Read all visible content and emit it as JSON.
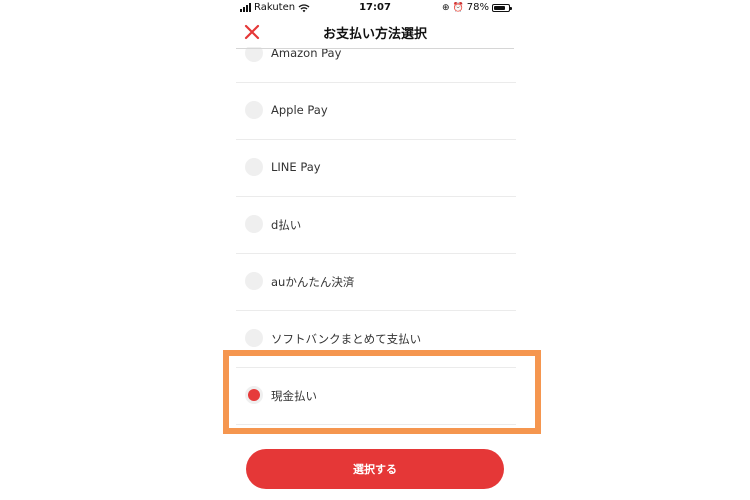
{
  "status_bar": {
    "carrier": "Rakuten",
    "time": "17:07",
    "battery": "78%",
    "battery_level": 0.78
  },
  "header": {
    "title": "お支払い方法選択",
    "close_icon": "close-x-icon",
    "accent_color": "#e53737"
  },
  "payment_methods": [
    {
      "label": "Amazon Pay",
      "selected": false
    },
    {
      "label": "Apple Pay",
      "selected": false
    },
    {
      "label": "LINE Pay",
      "selected": false
    },
    {
      "label": "d払い",
      "selected": false
    },
    {
      "label": "auかんたん決済",
      "selected": false
    },
    {
      "label": "ソフトバンクまとめて支払い",
      "selected": false
    },
    {
      "label": "現金払い",
      "selected": true
    }
  ],
  "highlight_color": "#f5964f",
  "select_button": {
    "label": "選択する"
  }
}
